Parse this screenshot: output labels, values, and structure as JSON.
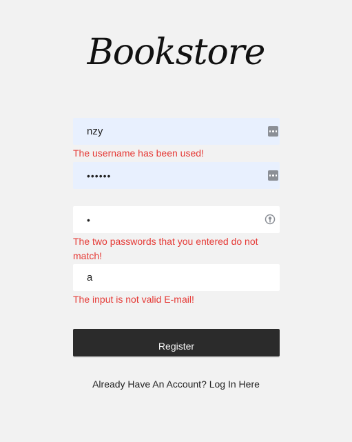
{
  "brand": {
    "logo_text": "Bookstore"
  },
  "form": {
    "username": {
      "value": "nzy",
      "error": "The username has been used!"
    },
    "password": {
      "value": "••••••"
    },
    "confirm_password": {
      "value": "•",
      "error": "The two passwords that you entered do not match!"
    },
    "email": {
      "value": "a",
      "error": "The input is not valid E-mail!"
    },
    "register_label": "Register"
  },
  "footer": {
    "login_link": "Already Have An Account? Log In Here"
  },
  "icons": {
    "autofill": "password-manager-icon",
    "key": "key-icon"
  },
  "colors": {
    "error": "#e53935",
    "autofill_bg": "#e8f0fe",
    "button_bg": "#2b2b2b",
    "page_bg": "#f2f2f2"
  }
}
